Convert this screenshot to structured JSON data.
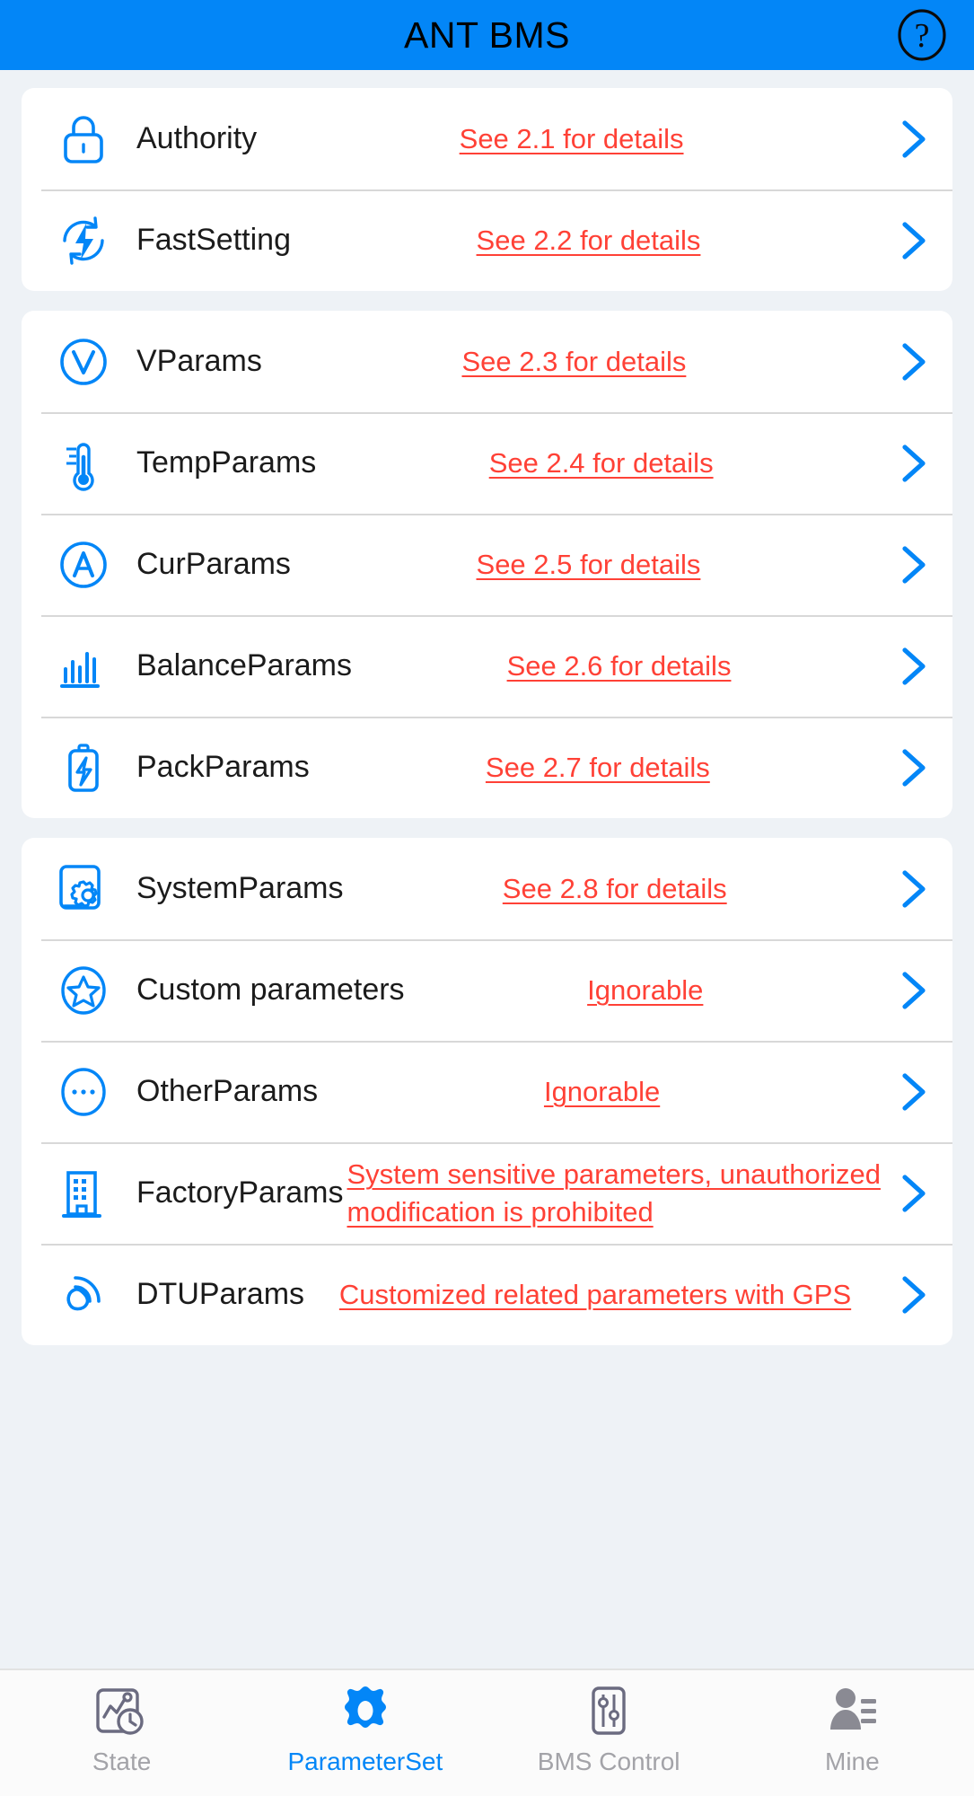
{
  "header": {
    "title": "ANT BMS",
    "help_icon": "question-circle-icon",
    "background_color": "#0386F7"
  },
  "theme": {
    "accent": "#0386F7",
    "note_color": "#FF4136",
    "page_background": "#eef2f6",
    "card_background": "#ffffff"
  },
  "groups": [
    {
      "rows": [
        {
          "icon": "lock-icon",
          "label": "Authority",
          "note": "See 2.1 for details",
          "chevron": "chevron-right-icon"
        },
        {
          "icon": "fast-sync-icon",
          "label": "FastSetting",
          "note": "See 2.2 for details",
          "chevron": "chevron-right-icon"
        }
      ]
    },
    {
      "rows": [
        {
          "icon": "voltage-circle-icon",
          "label": "VParams",
          "note": "See 2.3 for details",
          "chevron": "chevron-right-icon"
        },
        {
          "icon": "thermometer-icon",
          "label": "TempParams",
          "note": "See 2.4 for details",
          "chevron": "chevron-right-icon"
        },
        {
          "icon": "ampere-circle-icon",
          "label": "CurParams",
          "note": "See 2.5 for details",
          "chevron": "chevron-right-icon"
        },
        {
          "icon": "bar-chart-icon",
          "label": "BalanceParams",
          "note": "See 2.6 for details",
          "chevron": "chevron-right-icon"
        },
        {
          "icon": "battery-bolt-icon",
          "label": "PackParams",
          "note": "See 2.7 for details",
          "chevron": "chevron-right-icon"
        }
      ]
    },
    {
      "rows": [
        {
          "icon": "device-gear-icon",
          "label": "SystemParams",
          "note": "See 2.8 for details",
          "chevron": "chevron-right-icon"
        },
        {
          "icon": "star-circle-icon",
          "label": "Custom parameters",
          "note": "Ignorable",
          "chevron": "chevron-right-icon"
        },
        {
          "icon": "ellipsis-circle-icon",
          "label": "OtherParams",
          "note": "Ignorable",
          "chevron": "chevron-right-icon"
        },
        {
          "icon": "building-icon",
          "label": "FactoryParams",
          "note": "System sensitive parameters, unauthorized modification is prohibited",
          "chevron": "chevron-right-icon"
        },
        {
          "icon": "signal-wave-icon",
          "label": "DTUParams",
          "note": "Customized related parameters with GPS",
          "chevron": "chevron-right-icon"
        }
      ]
    }
  ],
  "bottom_nav": {
    "items": [
      {
        "icon": "chart-clock-icon",
        "label": "State",
        "active": false
      },
      {
        "icon": "gear-icon",
        "label": "ParameterSet",
        "active": true
      },
      {
        "icon": "sliders-icon",
        "label": "BMS Control",
        "active": false
      },
      {
        "icon": "person-list-icon",
        "label": "Mine",
        "active": false
      }
    ]
  }
}
